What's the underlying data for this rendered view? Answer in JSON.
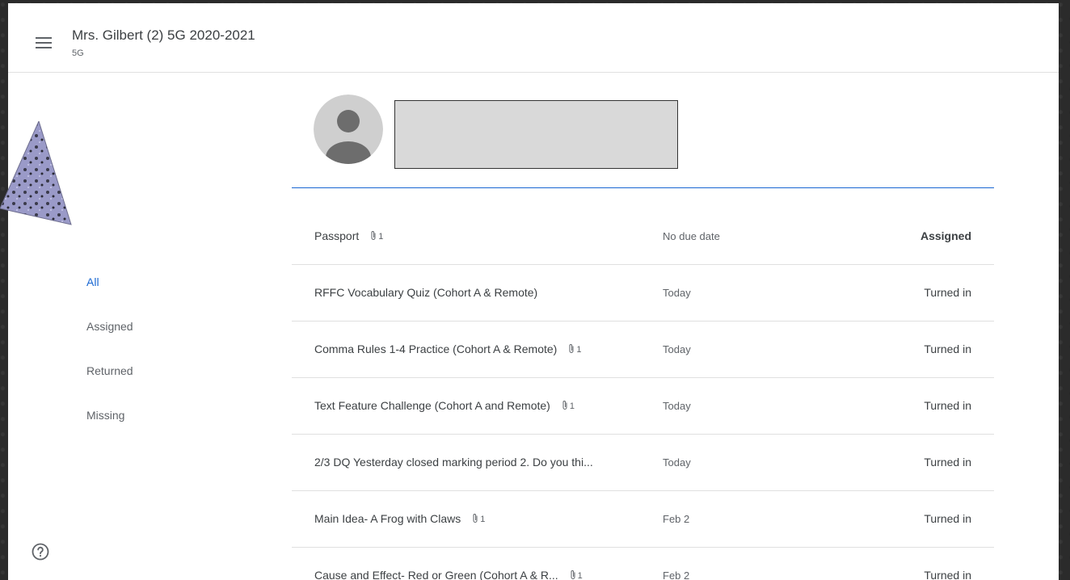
{
  "header": {
    "class_title": "Mrs. Gilbert (2) 5G 2020-2021",
    "class_section": "5G"
  },
  "sidebar": {
    "items": [
      {
        "label": "All",
        "active": true
      },
      {
        "label": "Assigned",
        "active": false
      },
      {
        "label": "Returned",
        "active": false
      },
      {
        "label": "Missing",
        "active": false
      }
    ]
  },
  "student": {
    "avatar_icon": "person-icon",
    "name": ""
  },
  "assignments": [
    {
      "title": "Passport",
      "attachments": "1",
      "due": "No due date",
      "status": "Assigned"
    },
    {
      "title": "RFFC Vocabulary Quiz (Cohort A & Remote)",
      "attachments": "",
      "due": "Today",
      "status": "Turned in"
    },
    {
      "title": "Comma Rules 1-4 Practice (Cohort A & Remote)",
      "attachments": "1",
      "due": "Today",
      "status": "Turned in"
    },
    {
      "title": "Text Feature Challenge (Cohort A and Remote)",
      "attachments": "1",
      "due": "Today",
      "status": "Turned in"
    },
    {
      "title": "2/3 DQ Yesterday closed marking period 2. Do you thi...",
      "attachments": "",
      "due": "Today",
      "status": "Turned in"
    },
    {
      "title": "Main Idea- A Frog with Claws",
      "attachments": "1",
      "due": "Feb 2",
      "status": "Turned in"
    },
    {
      "title": "Cause and Effect- Red or Green (Cohort A & R...",
      "attachments": "1",
      "due": "Feb 2",
      "status": "Turned in"
    }
  ],
  "colors": {
    "accent": "#1967d2",
    "text": "#3c4043",
    "muted": "#5f6368",
    "divider": "#e0e0e0"
  },
  "icons": {
    "menu": "hamburger-menu-icon",
    "attachment": "paperclip-icon",
    "help": "help-circle-icon"
  }
}
